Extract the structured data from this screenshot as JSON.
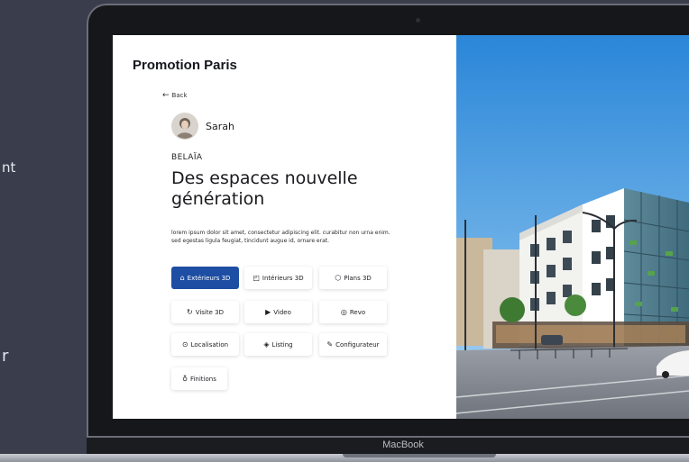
{
  "side": {
    "text1": "nt",
    "text2": "r"
  },
  "laptop": {
    "brand": "MacBook"
  },
  "app": {
    "title": "Promotion Paris",
    "back_label": "Back",
    "user_name": "Sarah",
    "project_name": "BELAÏA",
    "headline_line1": "Des espaces nouvelle",
    "headline_line2": "génération",
    "description": "lorem ipsum dolor sit amet, consectetur adipiscing elit. curabitur non urna enim. sed egestas ligula feugiat, tincidunt augue id, ornare erat.",
    "buttons": [
      {
        "label": "Extérieurs 3D",
        "icon": "building-icon",
        "active": true
      },
      {
        "label": "Intérieurs 3D",
        "icon": "interior-icon",
        "active": false
      },
      {
        "label": "Plans 3D",
        "icon": "cube-icon",
        "active": false
      },
      {
        "label": "Visite 3D",
        "icon": "rotate-icon",
        "active": false
      },
      {
        "label": "Video",
        "icon": "play-icon",
        "active": false
      },
      {
        "label": "Revo",
        "icon": "compass-icon",
        "active": false
      },
      {
        "label": "Localisation",
        "icon": "pin-icon",
        "active": false
      },
      {
        "label": "Listing",
        "icon": "tag-icon",
        "active": false
      },
      {
        "label": "Configurateur",
        "icon": "pencil-icon",
        "active": false
      },
      {
        "label": "Finitions",
        "icon": "bulb-icon",
        "active": false
      }
    ]
  },
  "colors": {
    "accent": "#1e4ea3",
    "background": "#3a3d4c",
    "screen": "#ffffff"
  }
}
